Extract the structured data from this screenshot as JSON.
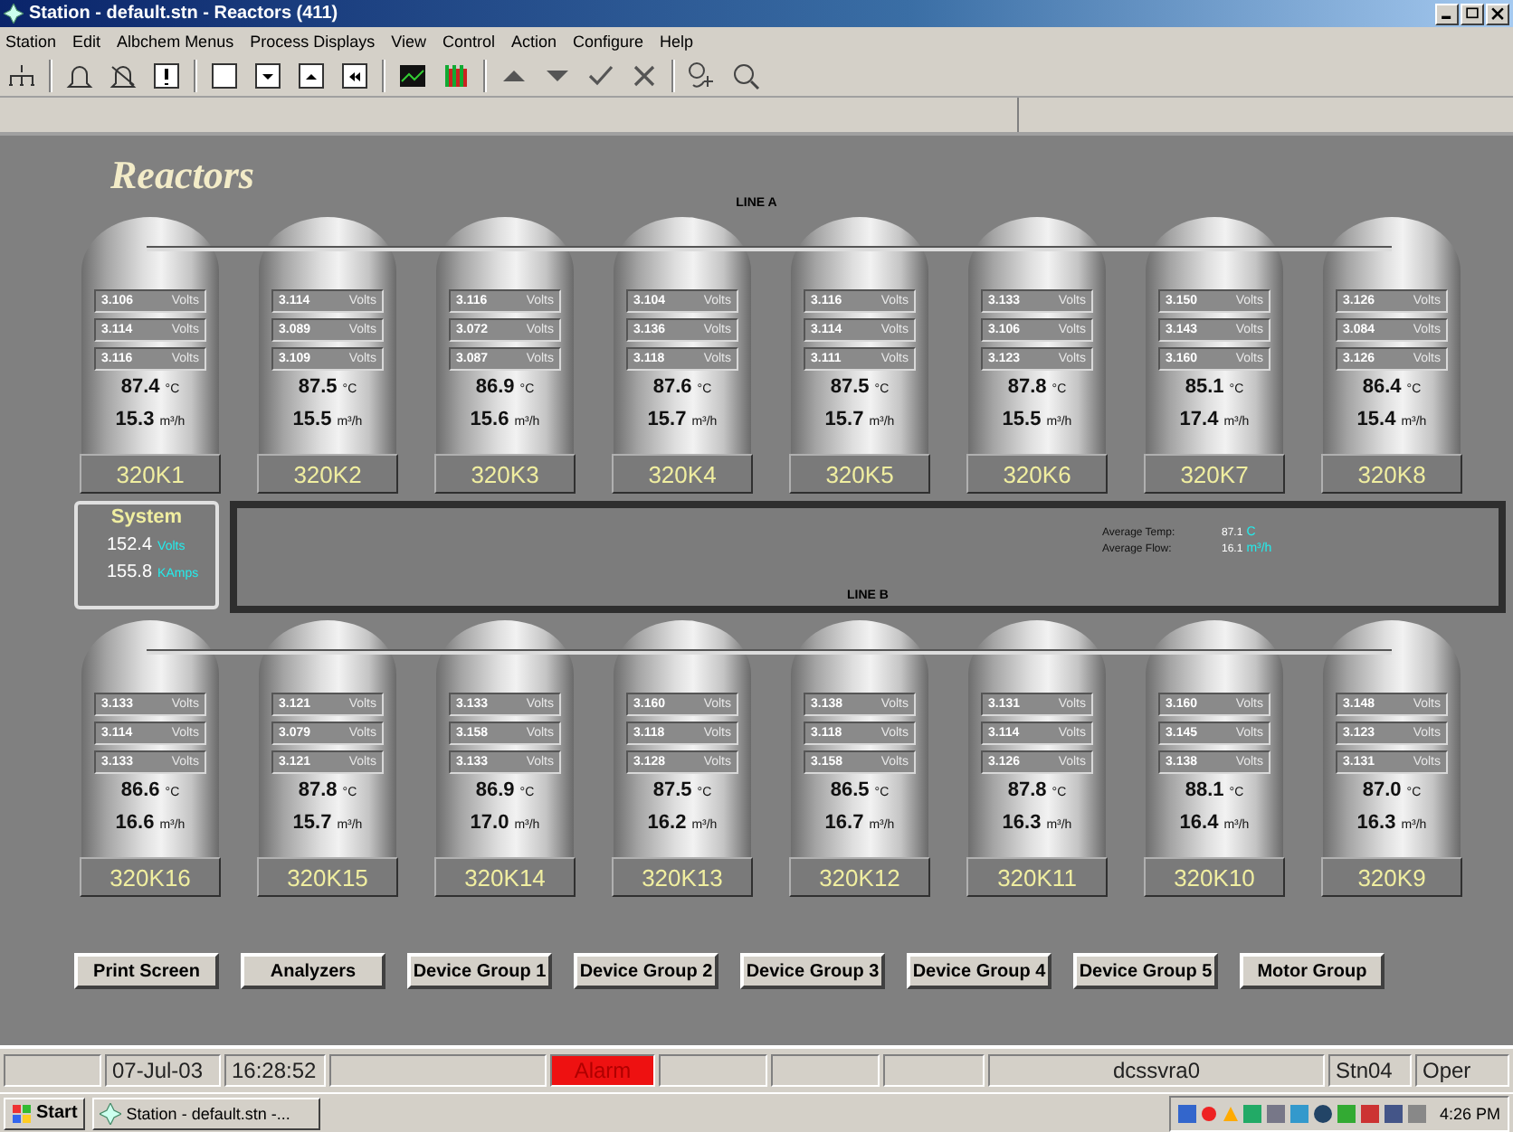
{
  "window": {
    "title": "Station - default.stn - Reactors (411)"
  },
  "menu": [
    "Station",
    "Edit",
    "Albchem Menus",
    "Process Displays",
    "View",
    "Control",
    "Action",
    "Configure",
    "Help"
  ],
  "display": {
    "title": "Reactors",
    "line_a": {
      "label": "LINE A",
      "reactors": [
        {
          "name": "320K1",
          "volts": [
            {
              "value": "3.106",
              "unit": "Volts"
            },
            {
              "value": "3.114",
              "unit": "Volts"
            },
            {
              "value": "3.116",
              "unit": "Volts"
            }
          ],
          "temp": {
            "value": "87.4",
            "unit": "°C"
          },
          "flow": {
            "value": "15.3",
            "unit": "m³/h"
          }
        },
        {
          "name": "320K2",
          "volts": [
            {
              "value": "3.114",
              "unit": "Volts"
            },
            {
              "value": "3.089",
              "unit": "Volts"
            },
            {
              "value": "3.109",
              "unit": "Volts"
            }
          ],
          "temp": {
            "value": "87.5",
            "unit": "°C"
          },
          "flow": {
            "value": "15.5",
            "unit": "m³/h"
          }
        },
        {
          "name": "320K3",
          "volts": [
            {
              "value": "3.116",
              "unit": "Volts"
            },
            {
              "value": "3.072",
              "unit": "Volts"
            },
            {
              "value": "3.087",
              "unit": "Volts"
            }
          ],
          "temp": {
            "value": "86.9",
            "unit": "°C"
          },
          "flow": {
            "value": "15.6",
            "unit": "m³/h"
          }
        },
        {
          "name": "320K4",
          "volts": [
            {
              "value": "3.104",
              "unit": "Volts"
            },
            {
              "value": "3.136",
              "unit": "Volts"
            },
            {
              "value": "3.118",
              "unit": "Volts"
            }
          ],
          "temp": {
            "value": "87.6",
            "unit": "°C"
          },
          "flow": {
            "value": "15.7",
            "unit": "m³/h"
          }
        },
        {
          "name": "320K5",
          "volts": [
            {
              "value": "3.116",
              "unit": "Volts"
            },
            {
              "value": "3.114",
              "unit": "Volts"
            },
            {
              "value": "3.111",
              "unit": "Volts"
            }
          ],
          "temp": {
            "value": "87.5",
            "unit": "°C"
          },
          "flow": {
            "value": "15.7",
            "unit": "m³/h"
          }
        },
        {
          "name": "320K6",
          "volts": [
            {
              "value": "3.133",
              "unit": "Volts"
            },
            {
              "value": "3.106",
              "unit": "Volts"
            },
            {
              "value": "3.123",
              "unit": "Volts"
            }
          ],
          "temp": {
            "value": "87.8",
            "unit": "°C"
          },
          "flow": {
            "value": "15.5",
            "unit": "m³/h"
          }
        },
        {
          "name": "320K7",
          "volts": [
            {
              "value": "3.150",
              "unit": "Volts"
            },
            {
              "value": "3.143",
              "unit": "Volts"
            },
            {
              "value": "3.160",
              "unit": "Volts"
            }
          ],
          "temp": {
            "value": "85.1",
            "unit": "°C"
          },
          "flow": {
            "value": "17.4",
            "unit": "m³/h"
          }
        },
        {
          "name": "320K8",
          "volts": [
            {
              "value": "3.126",
              "unit": "Volts"
            },
            {
              "value": "3.084",
              "unit": "Volts"
            },
            {
              "value": "3.126",
              "unit": "Volts"
            }
          ],
          "temp": {
            "value": "86.4",
            "unit": "°C"
          },
          "flow": {
            "value": "15.4",
            "unit": "m³/h"
          }
        }
      ]
    },
    "system": {
      "title": "System",
      "readings": [
        {
          "value": "152.4",
          "unit": "Volts"
        },
        {
          "value": "155.8",
          "unit": "KAmps"
        }
      ]
    },
    "averages": [
      {
        "label": "Average Temp:",
        "value": "87.1",
        "unit": "C"
      },
      {
        "label": "Average Flow:",
        "value": "16.1",
        "unit": "m³/h"
      }
    ],
    "line_b": {
      "label": "LINE B",
      "reactors": [
        {
          "name": "320K16",
          "volts": [
            {
              "value": "3.133",
              "unit": "Volts"
            },
            {
              "value": "3.114",
              "unit": "Volts"
            },
            {
              "value": "3.133",
              "unit": "Volts"
            }
          ],
          "temp": {
            "value": "86.6",
            "unit": "°C"
          },
          "flow": {
            "value": "16.6",
            "unit": "m³/h"
          }
        },
        {
          "name": "320K15",
          "volts": [
            {
              "value": "3.121",
              "unit": "Volts"
            },
            {
              "value": "3.079",
              "unit": "Volts"
            },
            {
              "value": "3.121",
              "unit": "Volts"
            }
          ],
          "temp": {
            "value": "87.8",
            "unit": "°C"
          },
          "flow": {
            "value": "15.7",
            "unit": "m³/h"
          }
        },
        {
          "name": "320K14",
          "volts": [
            {
              "value": "3.133",
              "unit": "Volts"
            },
            {
              "value": "3.158",
              "unit": "Volts"
            },
            {
              "value": "3.133",
              "unit": "Volts"
            }
          ],
          "temp": {
            "value": "86.9",
            "unit": "°C"
          },
          "flow": {
            "value": "17.0",
            "unit": "m³/h"
          }
        },
        {
          "name": "320K13",
          "volts": [
            {
              "value": "3.160",
              "unit": "Volts"
            },
            {
              "value": "3.118",
              "unit": "Volts"
            },
            {
              "value": "3.128",
              "unit": "Volts"
            }
          ],
          "temp": {
            "value": "87.5",
            "unit": "°C"
          },
          "flow": {
            "value": "16.2",
            "unit": "m³/h"
          }
        },
        {
          "name": "320K12",
          "volts": [
            {
              "value": "3.138",
              "unit": "Volts"
            },
            {
              "value": "3.118",
              "unit": "Volts"
            },
            {
              "value": "3.158",
              "unit": "Volts"
            }
          ],
          "temp": {
            "value": "86.5",
            "unit": "°C"
          },
          "flow": {
            "value": "16.7",
            "unit": "m³/h"
          }
        },
        {
          "name": "320K11",
          "volts": [
            {
              "value": "3.131",
              "unit": "Volts"
            },
            {
              "value": "3.114",
              "unit": "Volts"
            },
            {
              "value": "3.126",
              "unit": "Volts"
            }
          ],
          "temp": {
            "value": "87.8",
            "unit": "°C"
          },
          "flow": {
            "value": "16.3",
            "unit": "m³/h"
          }
        },
        {
          "name": "320K10",
          "volts": [
            {
              "value": "3.160",
              "unit": "Volts"
            },
            {
              "value": "3.145",
              "unit": "Volts"
            },
            {
              "value": "3.138",
              "unit": "Volts"
            }
          ],
          "temp": {
            "value": "88.1",
            "unit": "°C"
          },
          "flow": {
            "value": "16.4",
            "unit": "m³/h"
          }
        },
        {
          "name": "320K9",
          "volts": [
            {
              "value": "3.148",
              "unit": "Volts"
            },
            {
              "value": "3.123",
              "unit": "Volts"
            },
            {
              "value": "3.131",
              "unit": "Volts"
            }
          ],
          "temp": {
            "value": "87.0",
            "unit": "°C"
          },
          "flow": {
            "value": "16.3",
            "unit": "m³/h"
          }
        }
      ]
    },
    "buttons": [
      "Print Screen",
      "Analyzers",
      "Device Group 1",
      "Device Group 2",
      "Device Group 3",
      "Device Group 4",
      "Device Group 5",
      "Motor Group"
    ]
  },
  "status_bar": {
    "date": "07-Jul-03",
    "time": "16:28:52",
    "alarm": {
      "label": "Alarm",
      "active": true
    },
    "node": "dcssvra0",
    "station": "Stn04",
    "mode": "Oper"
  },
  "taskbar": {
    "start": "Start",
    "tasks": [
      {
        "label": "Station - default.stn -...",
        "selected": false
      }
    ],
    "clock": "4:26 PM"
  }
}
